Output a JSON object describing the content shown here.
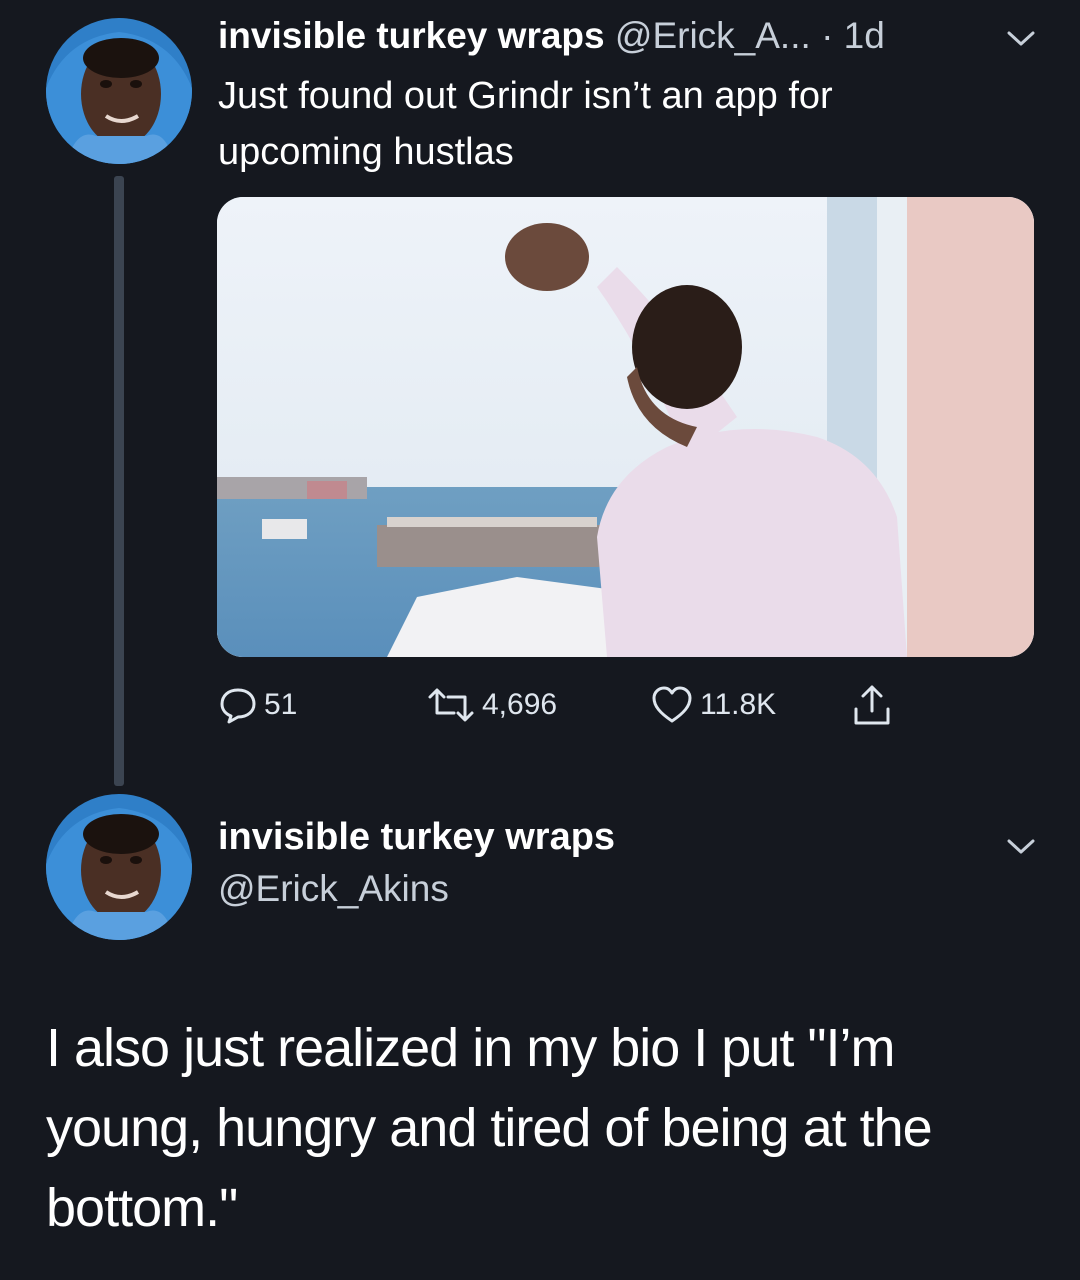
{
  "tweet": {
    "display_name": "invisible turkey wraps",
    "handle": "@Erick_A...",
    "time": "· 1d",
    "text": "Just found out Grindr isn’t an app for upcoming hustlas",
    "avatar_icon": "profile-photo-icon",
    "media_icon": "photo-man-at-window-harbor-icon",
    "actions": {
      "replies": "51",
      "retweets": "4,696",
      "likes": "11.8K"
    }
  },
  "reply": {
    "display_name": "invisible turkey wraps",
    "handle": "@Erick_Akins",
    "text": "I also just realized in my bio I put \"I’m young, hungry and tired of being at the bottom.\""
  },
  "colors": {
    "background": "#15181f",
    "text": "#ffffff",
    "secondary_text": "#c7cfd9",
    "thread_line": "#3b4451"
  }
}
